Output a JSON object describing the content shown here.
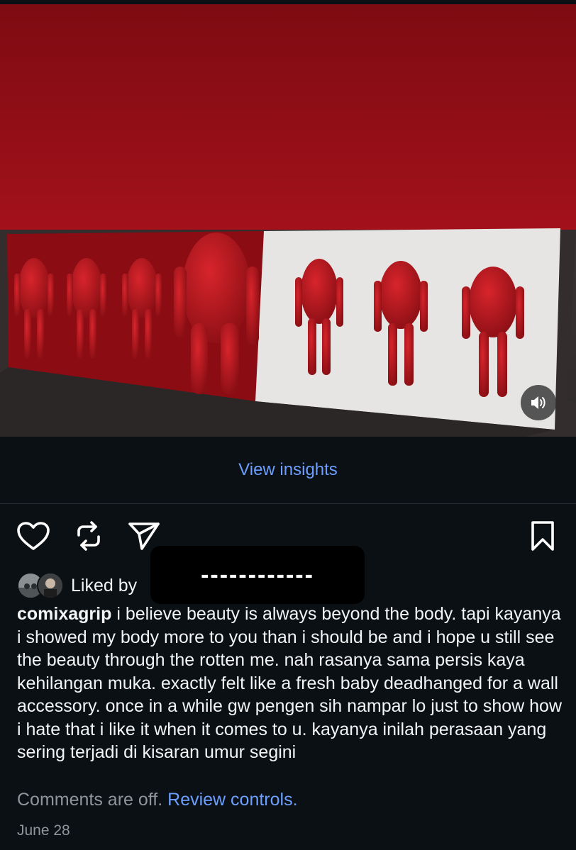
{
  "post": {
    "media_alt": "red headless baby doll sculptures mounted on a wall under a red panel",
    "insights_label": "View insights",
    "liked_by_label": "Liked by",
    "redacted_text": "------------",
    "caption_user": "comixagrip",
    "caption_text": "i believe beauty is always beyond the body. tapi kayanya i showed my body more to you than i should be and i hope u still see the beauty through the rotten me. nah rasanya sama persis kaya kehilangan muka. exactly felt like a fresh baby deadhanged for a wall accessory. once in a while gw pengen sih nampar lo just to show how i hate that i like it when it comes to u. kayanya inilah perasaan yang sering terjadi di kisaran umur segini",
    "comments_off": "Comments are off.",
    "review_controls": "Review controls.",
    "date": "June 28"
  },
  "icons": {
    "like": "heart-icon",
    "repost": "repost-icon",
    "share": "send-icon",
    "save": "bookmark-icon",
    "sound": "speaker-icon"
  },
  "colors": {
    "background": "#0b1014",
    "link": "#6c9fff",
    "muted_text": "#8e969c"
  }
}
